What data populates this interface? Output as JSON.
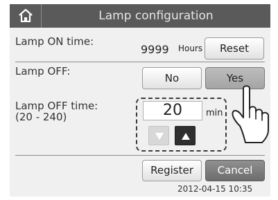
{
  "header": {
    "title": "Lamp configuration",
    "home_icon": "home-icon"
  },
  "lamp_on": {
    "label": "Lamp ON time:",
    "value": "9999",
    "unit": "Hours",
    "reset_label": "Reset"
  },
  "lamp_off": {
    "label": "Lamp OFF:",
    "no_label": "No",
    "yes_label": "Yes",
    "selected": "Yes"
  },
  "lamp_off_time": {
    "label": "Lamp OFF time:",
    "range": "(20 - 240)",
    "value": "20",
    "unit": "min"
  },
  "actions": {
    "register_label": "Register",
    "cancel_label": "Cancel"
  },
  "datetime": "2012-04-15 10:35",
  "colors": {
    "title_bar": "#5a5a5a",
    "panel": "#f0f0f0",
    "selected_button": "#a9a9a9",
    "cancel_button": "#777777"
  }
}
